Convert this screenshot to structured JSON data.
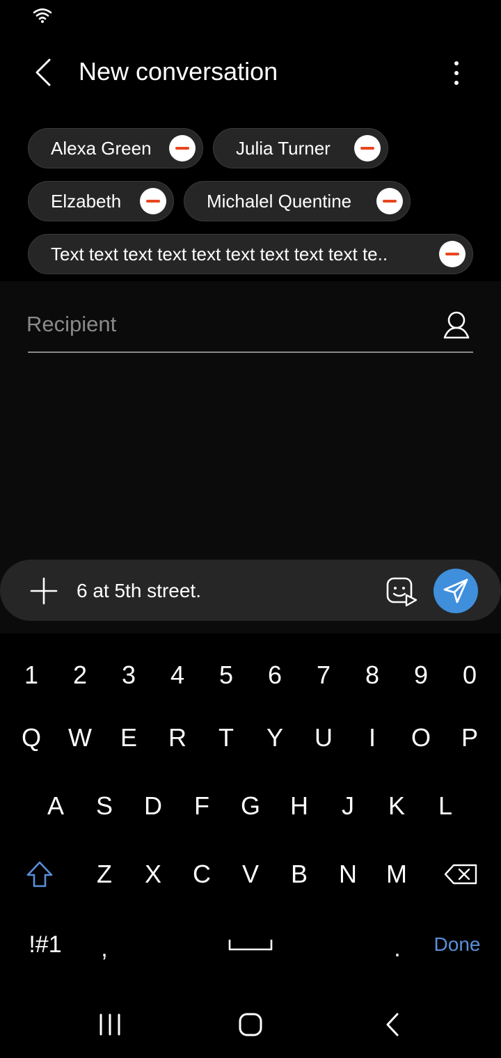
{
  "status_bar": {
    "wifi_icon": "wifi-icon"
  },
  "app_bar": {
    "title": "New conversation",
    "back_icon": "chevron-left-icon",
    "more_icon": "more-vertical-icon"
  },
  "chips": [
    {
      "label": "Alexa Green"
    },
    {
      "label": "Julia Turner"
    },
    {
      "label": "Elzabeth"
    },
    {
      "label": "Michalel Quentine"
    },
    {
      "label": "Text text text text text text text text text te.."
    }
  ],
  "recipient": {
    "placeholder": "Recipient",
    "contact_icon": "person-icon"
  },
  "composer": {
    "message": "6 at 5th street.",
    "add_icon": "plus-icon",
    "sticker_icon": "sticker-icon",
    "send_icon": "send-icon",
    "send_color": "#3f8fdc"
  },
  "keyboard": {
    "number_row": [
      "1",
      "2",
      "3",
      "4",
      "5",
      "6",
      "7",
      "8",
      "9",
      "0"
    ],
    "row1": [
      "Q",
      "W",
      "E",
      "R",
      "T",
      "Y",
      "U",
      "I",
      "O",
      "P"
    ],
    "row2": [
      "A",
      "S",
      "D",
      "F",
      "G",
      "H",
      "J",
      "K",
      "L"
    ],
    "row3": [
      "Z",
      "X",
      "C",
      "V",
      "B",
      "N",
      "M"
    ],
    "symbols_label": "!#1",
    "comma_label": ",",
    "period_label": ".",
    "done_label": "Done",
    "shift_icon": "shift-icon",
    "backspace_icon": "backspace-icon",
    "space_icon": "space-icon",
    "accent_color": "#5b8fd8"
  },
  "nav_bar": {
    "recents_icon": "recents-icon",
    "home_icon": "home-icon",
    "back_icon": "back-icon"
  },
  "colors": {
    "chip_remove": "#e8461e",
    "chip_background": "#262626"
  }
}
